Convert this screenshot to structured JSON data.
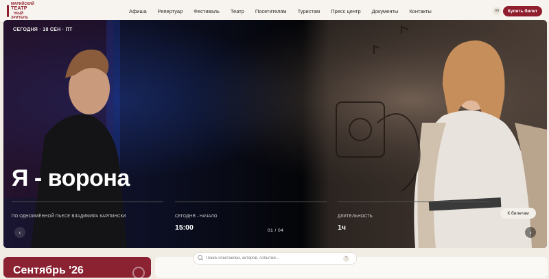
{
  "header": {
    "logo": {
      "line1": "МАРИЙСКИЙ",
      "line2": "ТЕАТР",
      "line3": "ЮНЫЙ ЗРИТЕЛЬ"
    },
    "nav": [
      "Афиша",
      "Репертуар",
      "Фестиваль",
      "Театр",
      "Посетителям",
      "Туристам",
      "Пресс центр",
      "Документы",
      "Контакты"
    ],
    "lang": "09",
    "buy_label": "Купить билет"
  },
  "hero": {
    "date": "СЕГОДНЯ · 18 СЕН · ПТ",
    "title": "Я - ворона",
    "info": [
      {
        "label": "ПО ОДНОИМЁННОЙ ПЬЕСЕ ВЛАДИМИРА КАРПИНСКИ",
        "value": ""
      },
      {
        "label": "СЕГОДНЯ - НАЧАЛО",
        "value": "15:00"
      },
      {
        "label": "ДЛИТЕЛЬНОСТЬ",
        "value": "1ч"
      }
    ],
    "tickets_label": "К билетам",
    "counter": "01 / 04",
    "prev_symbol": "‹",
    "next_symbol": "›"
  },
  "calendar": {
    "month_label": "Сентябрь '26"
  },
  "search": {
    "placeholder": "Поиск спектаклей, актёров, событий...",
    "help_symbol": "?"
  },
  "colors": {
    "accent": "#8f1d2c",
    "background": "#f1ece4",
    "hero_dark": "#0b0c12"
  }
}
